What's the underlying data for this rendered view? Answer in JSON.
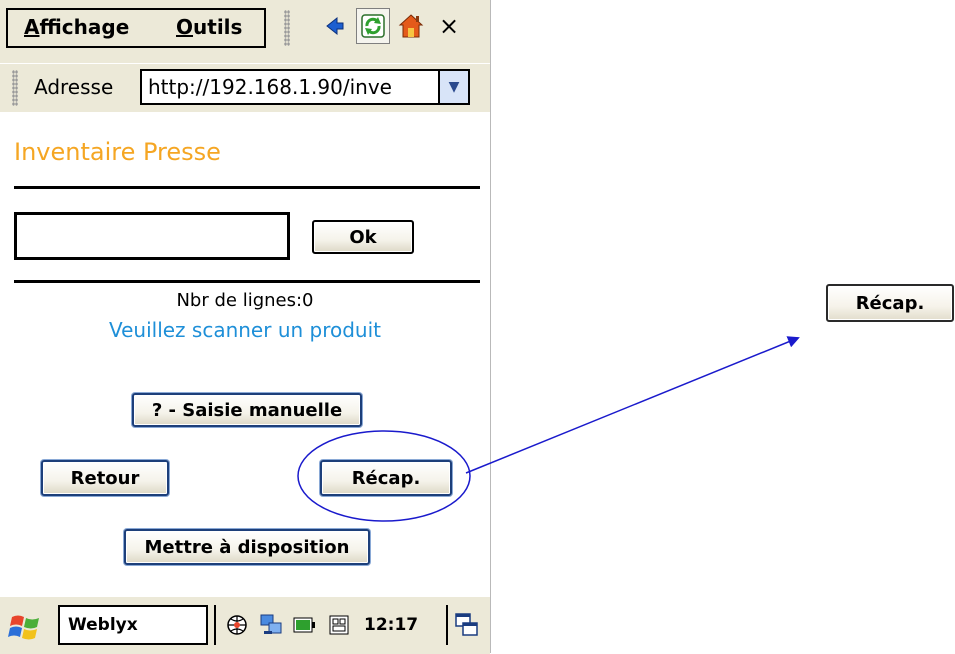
{
  "menubar": {
    "items": [
      {
        "label_first": "A",
        "label_rest": "ffichage"
      },
      {
        "label_first": "O",
        "label_rest": "utils"
      }
    ],
    "toolbar_close": "×"
  },
  "address": {
    "label": "Adresse",
    "value": "http://192.168.1.90/inve"
  },
  "page": {
    "title": "Inventaire Presse",
    "ok_label": "Ok",
    "line_count": "Nbr de lignes:0",
    "message": "Veuillez scanner un produit",
    "manual_label": "? - Saisie manuelle",
    "back_label": "Retour",
    "recap_label": "Récap.",
    "dispose_label": "Mettre à disposition"
  },
  "taskbar": {
    "task_label": "Weblyx",
    "clock": "12:17"
  },
  "callout": {
    "button_label": "Récap."
  },
  "colors": {
    "title": "#f5a623",
    "message": "#1e8fd8",
    "annotation": "#1a1acc"
  },
  "icons": [
    "back-arrow-icon",
    "refresh-icon",
    "home-icon",
    "close-icon",
    "windows-start-icon",
    "network-icon",
    "connection-icon",
    "battery-icon",
    "keyboard-icon",
    "window-switch-icon"
  ]
}
